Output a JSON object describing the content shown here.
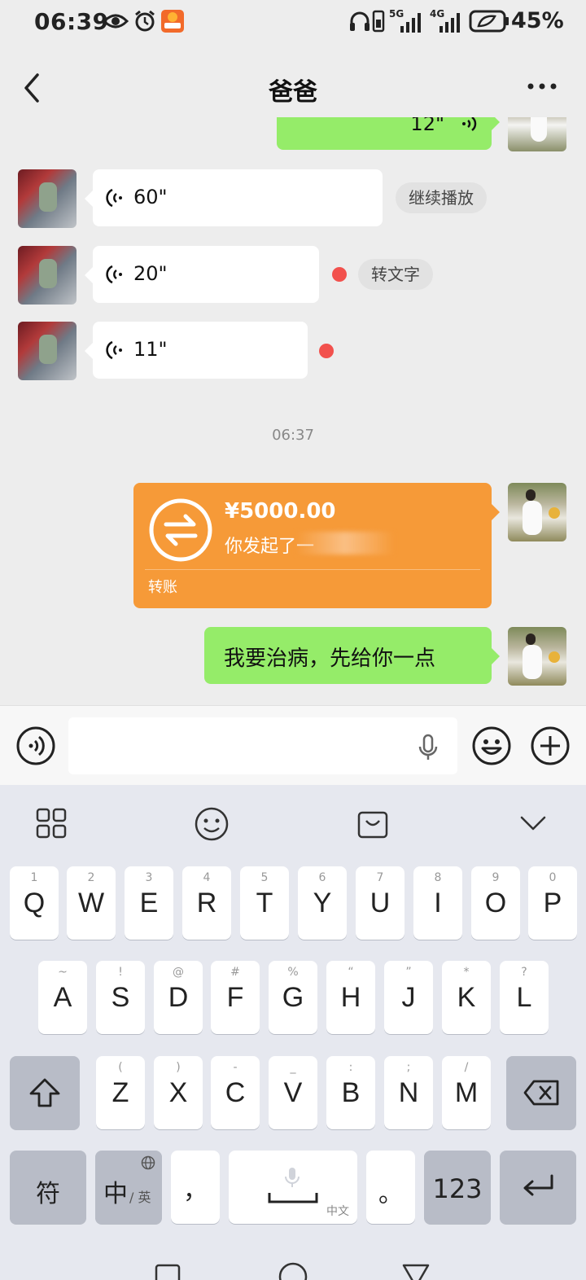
{
  "status_bar": {
    "time": "06:39",
    "network_1": "5G",
    "network_2": "4G",
    "battery": "45%"
  },
  "header": {
    "title": "爸爸",
    "back_icon": "chevron-left-icon",
    "more_icon": "more-dots-icon"
  },
  "chat": {
    "partial_message": {
      "duration": "12\""
    },
    "voice_messages": [
      {
        "duration": "60\"",
        "action": "继续播放"
      },
      {
        "duration": "20\"",
        "action": "转文字"
      },
      {
        "duration": "11\""
      }
    ],
    "timestamp": "06:37",
    "transfer": {
      "amount": "¥5000.00",
      "description": "你发起了一",
      "label": "转账"
    },
    "text_message": "我要治病，先给你一点"
  },
  "input_bar": {
    "voice_toggle_icon": "voice-toggle-icon",
    "mic_icon": "microphone-icon",
    "emoji_icon": "emoji-icon",
    "plus_icon": "plus-icon"
  },
  "keyboard": {
    "toolbar_icons": [
      "grid-apps-icon",
      "smile-icon",
      "shopping-bag-icon",
      "collapse-chevron-icon"
    ],
    "row1": [
      {
        "letter": "Q",
        "hint": "1"
      },
      {
        "letter": "W",
        "hint": "2"
      },
      {
        "letter": "E",
        "hint": "3"
      },
      {
        "letter": "R",
        "hint": "4"
      },
      {
        "letter": "T",
        "hint": "5"
      },
      {
        "letter": "Y",
        "hint": "6"
      },
      {
        "letter": "U",
        "hint": "7"
      },
      {
        "letter": "I",
        "hint": "8"
      },
      {
        "letter": "O",
        "hint": "9"
      },
      {
        "letter": "P",
        "hint": "0"
      }
    ],
    "row2": [
      {
        "letter": "A",
        "hint": "~"
      },
      {
        "letter": "S",
        "hint": "!"
      },
      {
        "letter": "D",
        "hint": "@"
      },
      {
        "letter": "F",
        "hint": "#"
      },
      {
        "letter": "G",
        "hint": "%"
      },
      {
        "letter": "H",
        "hint": "“"
      },
      {
        "letter": "J",
        "hint": "”"
      },
      {
        "letter": "K",
        "hint": "*"
      },
      {
        "letter": "L",
        "hint": "?"
      }
    ],
    "row3": [
      {
        "letter": "Z",
        "hint": "("
      },
      {
        "letter": "X",
        "hint": ")"
      },
      {
        "letter": "C",
        "hint": "-"
      },
      {
        "letter": "V",
        "hint": "_"
      },
      {
        "letter": "B",
        "hint": ":"
      },
      {
        "letter": "N",
        "hint": ";"
      },
      {
        "letter": "M",
        "hint": "/"
      }
    ],
    "bottom": {
      "symbols": "符",
      "lang_main": "中",
      "lang_alt": "/ 英",
      "comma": "，",
      "space_hint": "中文",
      "period": "。",
      "numbers": "123"
    }
  },
  "colors": {
    "accent_green": "#95ec69",
    "transfer_orange": "#f69a38",
    "unread_red": "#f2514d"
  }
}
